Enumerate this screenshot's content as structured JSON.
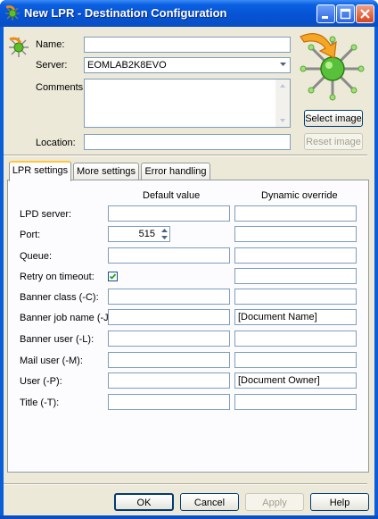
{
  "window": {
    "title": "New LPR - Destination Configuration"
  },
  "form": {
    "name_label": "Name:",
    "name_value": "",
    "server_label": "Server:",
    "server_value": "EOMLAB2K8EVO",
    "comments_label": "Comments:",
    "comments_value": "",
    "location_label": "Location:",
    "location_value": ""
  },
  "image_buttons": {
    "select": "Select image",
    "reset": "Reset image"
  },
  "tabs": [
    {
      "label": "LPR settings",
      "active": true
    },
    {
      "label": "More settings",
      "active": false
    },
    {
      "label": "Error handling",
      "active": false
    }
  ],
  "grid": {
    "col_default": "Default value",
    "col_dynamic": "Dynamic override",
    "rows": [
      {
        "label": "LPD server:",
        "default": "",
        "dynamic": ""
      },
      {
        "label": "Port:",
        "default": "515",
        "dynamic": ""
      },
      {
        "label": "Queue:",
        "default": "",
        "dynamic": ""
      },
      {
        "label": "Retry on timeout:",
        "default": "",
        "dynamic": ""
      },
      {
        "label": "Banner class (-C):",
        "default": "",
        "dynamic": ""
      },
      {
        "label": "Banner job name (-J):",
        "default": "",
        "dynamic": "[Document Name]"
      },
      {
        "label": "Banner user (-L):",
        "default": "",
        "dynamic": ""
      },
      {
        "label": "Mail user (-M):",
        "default": "",
        "dynamic": ""
      },
      {
        "label": "User (-P):",
        "default": "",
        "dynamic": "[Document Owner]"
      },
      {
        "label": "Title (-T):",
        "default": "",
        "dynamic": ""
      }
    ],
    "retry_checked": true
  },
  "footer": {
    "ok": "OK",
    "cancel": "Cancel",
    "apply": "Apply",
    "help": "Help"
  },
  "colors": {
    "titlebar": "#0a5fd8",
    "dialog_bg": "#ece9d8",
    "close_button": "#d8451b"
  },
  "icons": [
    "destination-icon",
    "minimize-icon",
    "maximize-icon",
    "close-icon",
    "dropdown-arrow-icon",
    "spin-up-icon",
    "spin-down-icon",
    "checkmark-icon",
    "printer-destination-image"
  ]
}
